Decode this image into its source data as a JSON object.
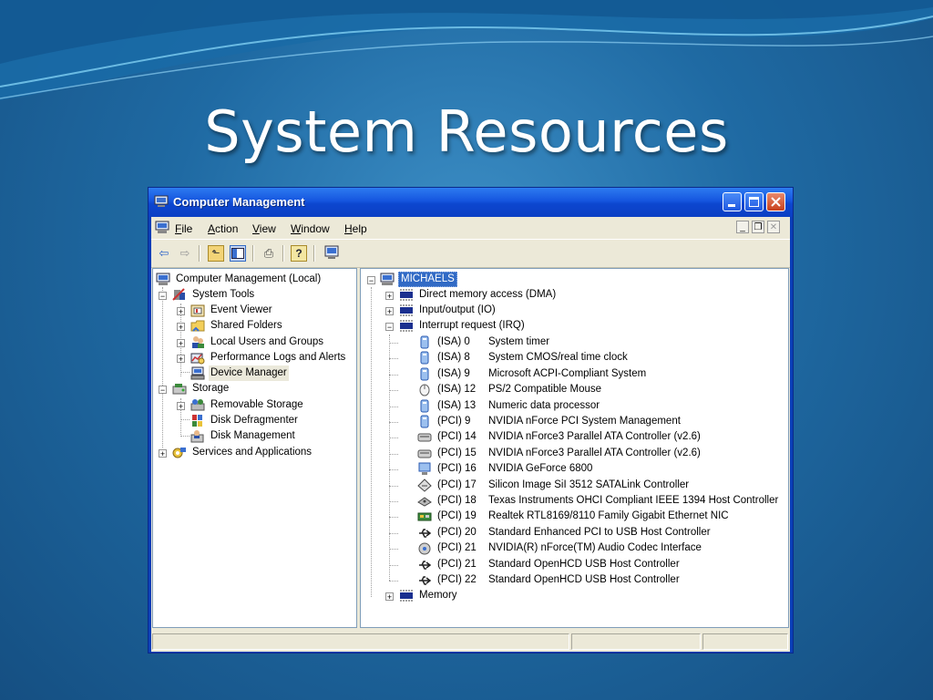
{
  "slide": {
    "title": "System Resources"
  },
  "window": {
    "title": "Computer Management",
    "menu": [
      "File",
      "Action",
      "View",
      "Window",
      "Help"
    ],
    "menu_underlines": [
      "F",
      "A",
      "V",
      "W",
      "H"
    ]
  },
  "toolbar": {
    "icons": [
      "back-arrow-icon",
      "forward-arrow-icon",
      "up-folder-icon",
      "show-hide-tree-icon",
      "print-icon",
      "help-icon",
      "properties-icon"
    ]
  },
  "tree": {
    "root": "Computer Management (Local)",
    "system_tools": "System Tools",
    "event_viewer": "Event Viewer",
    "shared_folders": "Shared Folders",
    "local_users": "Local Users and Groups",
    "perf_logs": "Performance Logs and Alerts",
    "device_manager": "Device Manager",
    "storage": "Storage",
    "removable_storage": "Removable Storage",
    "disk_defrag": "Disk Defragmenter",
    "disk_mgmt": "Disk Management",
    "services": "Services and Applications"
  },
  "devices": {
    "root": "MICHAELS",
    "dma": "Direct memory access (DMA)",
    "io": "Input/output (IO)",
    "irq": "Interrupt request (IRQ)",
    "memory": "Memory",
    "irq_items": [
      {
        "irq": "(ISA)  0",
        "name": "System timer",
        "icon": "system-device-icon"
      },
      {
        "irq": "(ISA)  8",
        "name": "System CMOS/real time clock",
        "icon": "system-device-icon"
      },
      {
        "irq": "(ISA)  9",
        "name": "Microsoft ACPI-Compliant System",
        "icon": "system-device-icon"
      },
      {
        "irq": "(ISA) 12",
        "name": "PS/2 Compatible Mouse",
        "icon": "mouse-icon"
      },
      {
        "irq": "(ISA) 13",
        "name": "Numeric data processor",
        "icon": "system-device-icon"
      },
      {
        "irq": "(PCI)  9",
        "name": "NVIDIA nForce PCI System Management",
        "icon": "system-device-icon"
      },
      {
        "irq": "(PCI) 14",
        "name": "NVIDIA nForce3 Parallel ATA Controller (v2.6)",
        "icon": "ide-controller-icon"
      },
      {
        "irq": "(PCI) 15",
        "name": "NVIDIA nForce3 Parallel ATA Controller (v2.6)",
        "icon": "ide-controller-icon"
      },
      {
        "irq": "(PCI) 16",
        "name": "NVIDIA GeForce 6800",
        "icon": "display-adapter-icon"
      },
      {
        "irq": "(PCI) 17",
        "name": "Silicon Image SiI 3512 SATALink Controller",
        "icon": "scsi-controller-icon"
      },
      {
        "irq": "(PCI) 18",
        "name": "Texas Instruments OHCI Compliant IEEE 1394 Host Controller",
        "icon": "firewire-icon"
      },
      {
        "irq": "(PCI) 19",
        "name": "Realtek RTL8169/8110 Family Gigabit Ethernet NIC",
        "icon": "network-card-icon"
      },
      {
        "irq": "(PCI) 20",
        "name": "Standard Enhanced PCI to USB Host Controller",
        "icon": "usb-icon"
      },
      {
        "irq": "(PCI) 21",
        "name": "NVIDIA(R) nForce(TM) Audio Codec Interface",
        "icon": "audio-icon"
      },
      {
        "irq": "(PCI) 21",
        "name": "Standard OpenHCD USB Host Controller",
        "icon": "usb-icon"
      },
      {
        "irq": "(PCI) 22",
        "name": "Standard OpenHCD USB Host Controller",
        "icon": "usb-icon"
      }
    ]
  },
  "colors": {
    "titlebar": "#0c46cf",
    "selection": "#316ac5",
    "window_face": "#ece9d8"
  }
}
